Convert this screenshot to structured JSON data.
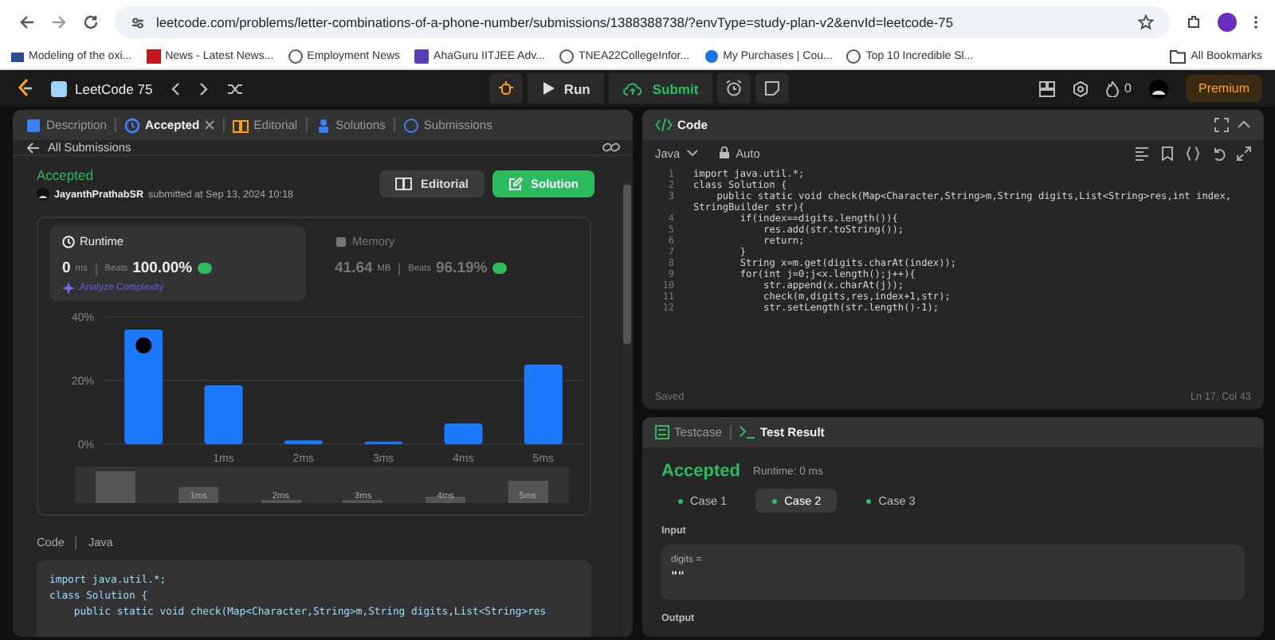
{
  "browser": {
    "url": "leetcode.com/problems/letter-combinations-of-a-phone-number/submissions/1388388738/?envType=study-plan-v2&envId=leetcode-75",
    "bookmarks": [
      "Modeling of the oxi...",
      "News - Latest News...",
      "Employment News",
      "AhaGuru IITJEE Adv...",
      "TNEA22CollegeInfor...",
      "My Purchases | Cou...",
      "Top 10 Incredible Sl..."
    ],
    "all_bookmarks": "All Bookmarks"
  },
  "navbar": {
    "title": "LeetCode 75",
    "run": "Run",
    "submit": "Submit",
    "streak": "0",
    "premium": "Premium"
  },
  "left_panel": {
    "tabs": [
      {
        "label": "Description",
        "selected": false
      },
      {
        "label": "Accepted",
        "selected": true
      },
      {
        "label": "Editorial",
        "selected": false
      },
      {
        "label": "Solutions",
        "selected": false
      },
      {
        "label": "Submissions",
        "selected": false
      }
    ],
    "back": "All Submissions",
    "status": "Accepted",
    "user": "JayanthPrathabSR",
    "submitted": "submitted at Sep 13, 2024 10:18",
    "buttons": [
      {
        "label": "Editorial",
        "kind": "secondary"
      },
      {
        "label": "Solution",
        "kind": "primary"
      }
    ],
    "stats": [
      {
        "label": "Runtime",
        "value": "0",
        "unit": "ms",
        "beats_label": "Beats",
        "beats": "100.00%",
        "link": "Analyze Complexity",
        "selected": true
      },
      {
        "label": "Memory",
        "value": "41.64",
        "unit": "MB",
        "beats_label": "Beats",
        "beats": "96.19%",
        "selected": false
      }
    ],
    "chart_data": {
      "type": "bar",
      "categories": [
        null,
        "1ms",
        "2ms",
        "3ms",
        "4ms",
        "5ms"
      ],
      "values": [
        36,
        18.5,
        1.2,
        0.8,
        6.5,
        25
      ],
      "ylim": [
        0,
        40
      ],
      "yticks": [
        {
          "value": 0,
          "label": "0%"
        },
        {
          "value": 20,
          "label": "20%"
        },
        {
          "value": 40,
          "label": "40%"
        }
      ]
    },
    "overview_labels": [
      "1ms",
      "2ms",
      "3ms",
      "4ms",
      "5ms"
    ],
    "code_label": "Code",
    "code_language": "Java",
    "code_lines": [
      "import java.util.*;",
      "class Solution {",
      "    public static void check(Map<Character,String>m,String digits,List<String>res"
    ]
  },
  "code_panel": {
    "title": "Code",
    "language": "Java",
    "mode": "Auto",
    "lines": [
      {
        "num": "1",
        "text": "import java.util.*;"
      },
      {
        "num": "2",
        "text": "class Solution {"
      },
      {
        "num": "3",
        "text": "    public static void check(Map<Character,String>m,String digits,List<String>res,int index, StringBuilder str){"
      },
      {
        "num": "4",
        "text": "        if(index==digits.length()){"
      },
      {
        "num": "5",
        "text": "            res.add(str.toString());"
      },
      {
        "num": "6",
        "text": "            return;"
      },
      {
        "num": "7",
        "text": "        }"
      },
      {
        "num": "8",
        "text": "        String x=m.get(digits.charAt(index));"
      },
      {
        "num": "9",
        "text": "        for(int j=0;j<x.length();j++){"
      },
      {
        "num": "10",
        "text": "            str.append(x.charAt(j));"
      },
      {
        "num": "11",
        "text": "            check(m,digits,res,index+1,str);"
      },
      {
        "num": "12",
        "text": "            str.setLength(str.length()-1);"
      }
    ],
    "saved": "Saved",
    "cursor": "Ln 17, Col 43"
  },
  "result_panel": {
    "tabs": [
      {
        "label": "Testcase",
        "selected": false
      },
      {
        "label": "Test Result",
        "selected": true
      }
    ],
    "status": "Accepted",
    "runtime": "Runtime: 0 ms",
    "cases": [
      {
        "label": "Case 1",
        "selected": false
      },
      {
        "label": "Case 2",
        "selected": true
      },
      {
        "label": "Case 3",
        "selected": false
      }
    ],
    "input_label": "Input",
    "input_name": "digits =",
    "input_value": "\"\"",
    "output_label": "Output"
  }
}
